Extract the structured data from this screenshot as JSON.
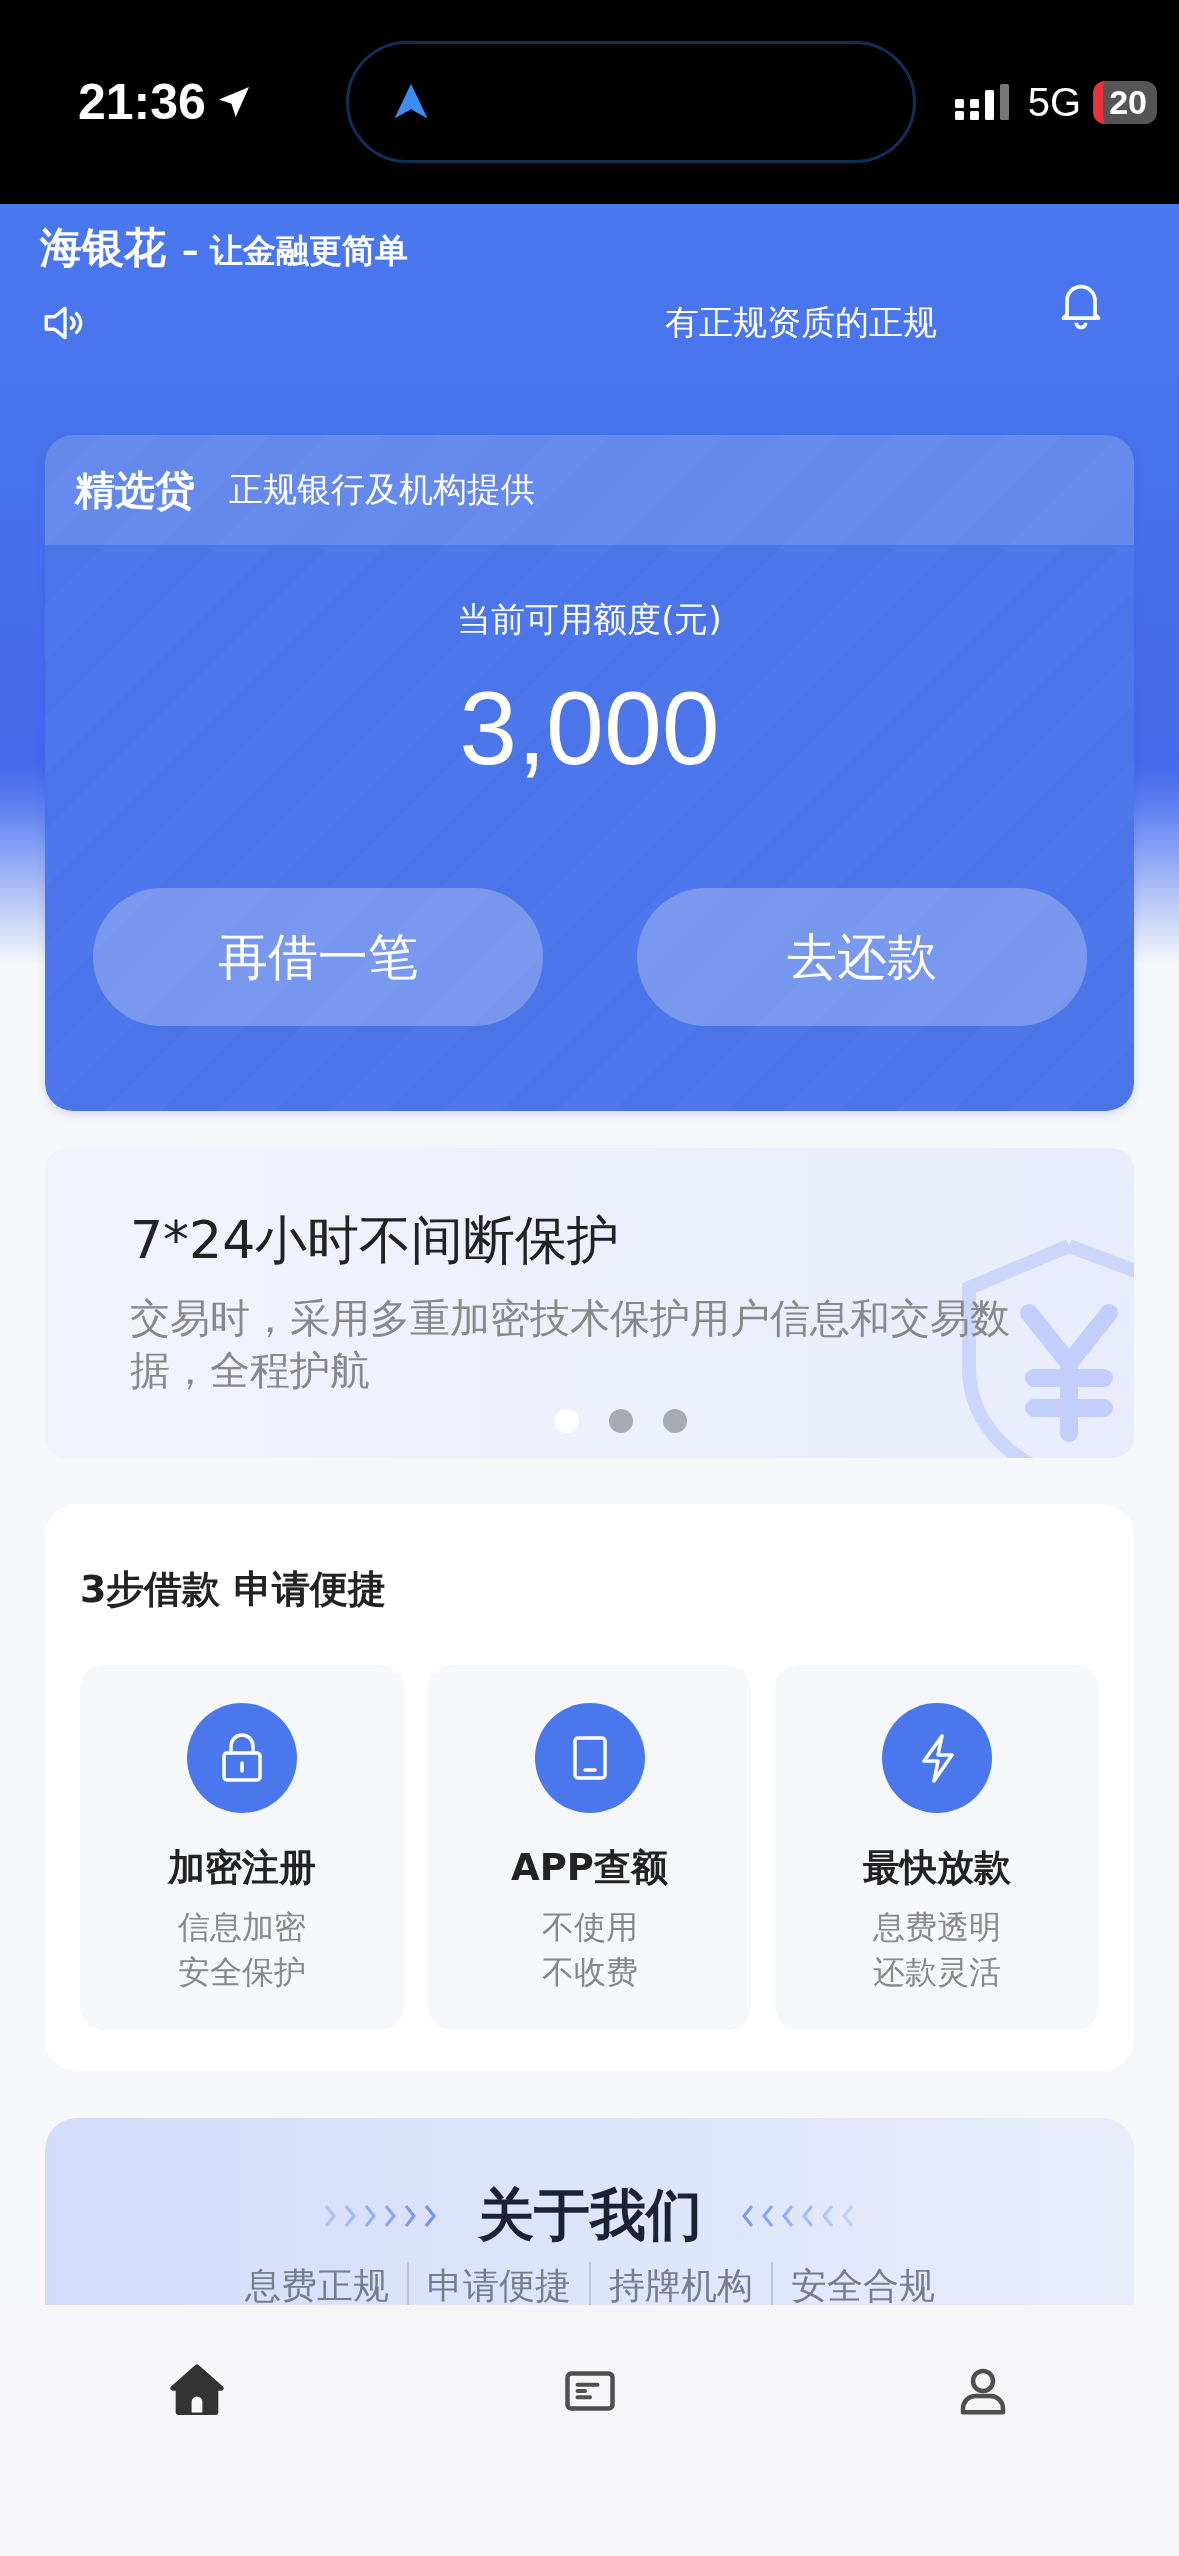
{
  "status_bar": {
    "time": "21:36",
    "network": "5G",
    "battery": "20"
  },
  "header": {
    "brand": "海银花",
    "slogan": "– 让金融更简单",
    "notice": "有正规资质的正规"
  },
  "loan_card": {
    "title": "精选贷",
    "subtitle": "正规银行及机构提供",
    "amount_label": "当前可用额度(元)",
    "amount": "3,000",
    "buttons": [
      "再借一笔",
      "去还款"
    ]
  },
  "banner": {
    "title": "7*24小时不间断保护",
    "text": "交易时，采用多重加密技术保护用户信息和交易数据，全程护航",
    "dots": [
      {
        "selected": true
      },
      {
        "selected": false
      },
      {
        "selected": false
      }
    ]
  },
  "steps": {
    "title": "3步借款 申请便捷",
    "items": [
      {
        "kind": "lock",
        "title": "加密注册",
        "lines": [
          "信息加密",
          "安全保护"
        ]
      },
      {
        "kind": "tablet",
        "title": "APP查额",
        "lines": [
          "不使用",
          "不收费"
        ]
      },
      {
        "kind": "bolt",
        "title": "最快放款",
        "lines": [
          "息费透明",
          "还款灵活"
        ]
      }
    ]
  },
  "about": {
    "title": "关于我们",
    "tags": [
      "息费正规",
      "申请便捷",
      "持牌机构",
      "安全合规"
    ]
  },
  "tab_bar": {
    "tabs": [
      {
        "kind": "home",
        "selected": true
      },
      {
        "kind": "list",
        "selected": false
      },
      {
        "kind": "user",
        "selected": false
      }
    ]
  }
}
